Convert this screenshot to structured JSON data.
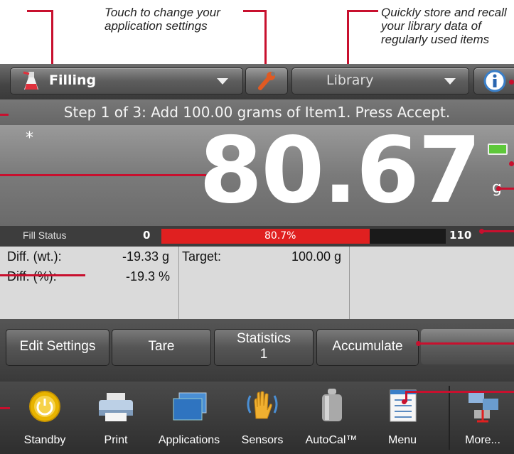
{
  "annotations": {
    "settings_tip_line1": "Touch to change your",
    "settings_tip_line2": "application settings",
    "library_tip_line1": "Quickly store and recall",
    "library_tip_line2": "your library data of",
    "library_tip_line3": "regularly used items"
  },
  "topbar": {
    "application": "Filling",
    "library": "Library"
  },
  "step_message": "Step 1 of 3: Add 100.00 grams of Item1.  Press Accept.",
  "readout": {
    "stability_marker": "*",
    "weight": "80.67",
    "unit": "g"
  },
  "fill_status": {
    "label": "Fill Status",
    "min": "0",
    "max": "110",
    "percent_text": "80.7%",
    "fill_fraction": 0.733
  },
  "info": {
    "diff_wt_label": "Diff. (wt.):",
    "diff_wt_value": "-19.33 g",
    "diff_pct_label": "Diff. (%):",
    "diff_pct_value": "-19.3 %",
    "target_label": "Target:",
    "target_value": "100.00 g"
  },
  "softkeys": {
    "edit_settings": "Edit Settings",
    "tare": "Tare",
    "statistics": "Statistics",
    "statistics_count": "1",
    "accumulate": "Accumulate"
  },
  "navbar": {
    "standby": "Standby",
    "print": "Print",
    "applications": "Applications",
    "sensors": "Sensors",
    "autocal": "AutoCal™",
    "menu": "Menu",
    "more": "More..."
  },
  "colors": {
    "callout": "#c8102e",
    "fill_bar": "#e02020",
    "battery": "#5ec83a"
  }
}
